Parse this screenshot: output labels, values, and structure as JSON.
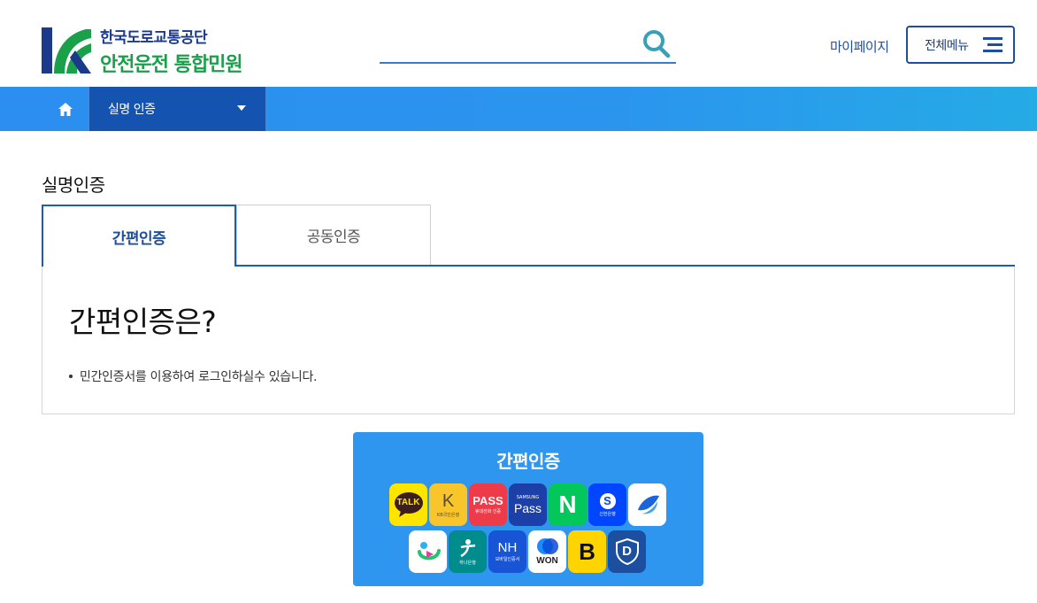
{
  "header": {
    "logo_org": "한국도로교통공단",
    "logo_service": "안전운전 통합민원",
    "search_placeholder": "",
    "mypage_label": "마이페이지",
    "allmenu_label": "전체메뉴"
  },
  "nav": {
    "current_menu": "실명 인증"
  },
  "main": {
    "page_title": "실명인증",
    "tabs": [
      {
        "label": "간편인증",
        "active": true
      },
      {
        "label": "공동인증",
        "active": false
      }
    ],
    "info_title": "간편인증은?",
    "info_bullet": "민간인증서를 이용하여 로그인하실수 있습니다."
  },
  "easy_cert": {
    "title": "간편인증",
    "apps_row1": [
      {
        "name": "kakaotalk",
        "label": "TALK",
        "sub": ""
      },
      {
        "name": "kb-bank",
        "label": "K",
        "sub": "KB국민은행"
      },
      {
        "name": "pass",
        "label": "PASS",
        "sub": "휴대전화 인증"
      },
      {
        "name": "samsung-pass",
        "label": "Pass",
        "sub": "SAMSUNG"
      },
      {
        "name": "naver",
        "label": "N",
        "sub": ""
      },
      {
        "name": "shinhan-bank",
        "label": "S",
        "sub": "신한은행"
      },
      {
        "name": "toss",
        "label": "",
        "sub": ""
      }
    ],
    "apps_row2": [
      {
        "name": "payco",
        "label": "",
        "sub": ""
      },
      {
        "name": "hana-bank",
        "label": "",
        "sub": "하나은행"
      },
      {
        "name": "nh-bank",
        "label": "NH",
        "sub": "모바일인증서"
      },
      {
        "name": "woori-won",
        "label": "WON",
        "sub": ""
      },
      {
        "name": "banksalad",
        "label": "B",
        "sub": ""
      },
      {
        "name": "dream-security",
        "label": "D",
        "sub": ""
      }
    ]
  },
  "colors": {
    "primary": "#1d4f9a",
    "nav_bg": "#2b8ef0",
    "nav_active": "#1553b0",
    "logo_green": "#1aa04a",
    "easy_cert_bg": "#2f96f0"
  }
}
